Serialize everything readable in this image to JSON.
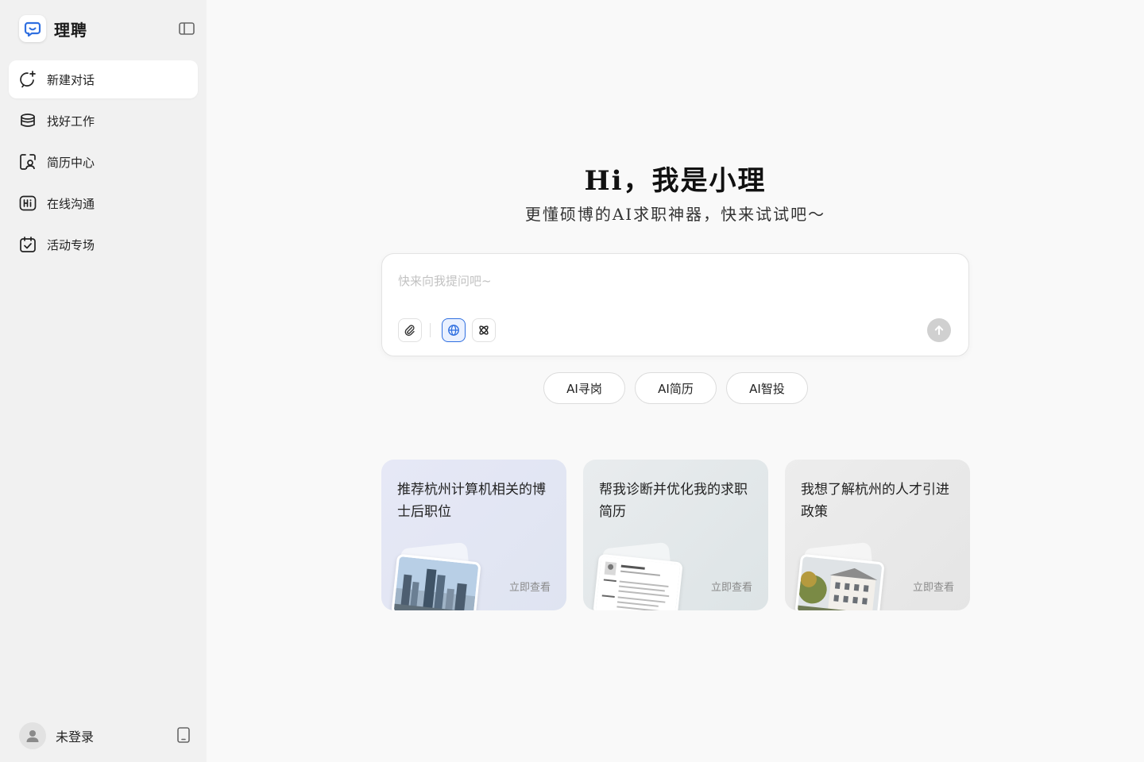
{
  "brand": {
    "name": "理聘",
    "accent": "#2f6fe0"
  },
  "sidebar": {
    "items": [
      {
        "label": "新建对话",
        "icon": "new-chat-icon",
        "active": true
      },
      {
        "label": "找好工作",
        "icon": "briefcase-icon",
        "active": false
      },
      {
        "label": "简历中心",
        "icon": "resume-icon",
        "active": false
      },
      {
        "label": "在线沟通",
        "icon": "hi-chat-icon",
        "active": false
      },
      {
        "label": "活动专场",
        "icon": "calendar-check-icon",
        "active": false
      }
    ],
    "user_label": "未登录"
  },
  "hero": {
    "title": "Hi，我是小理",
    "subtitle": "更懂硕博的AI求职神器，快来试试吧～"
  },
  "composer": {
    "placeholder": "快来向我提问吧~",
    "value": ""
  },
  "chips": [
    "AI寻岗",
    "AI简历",
    "AI智投"
  ],
  "cards": [
    {
      "title": "推荐杭州计算机相关的博士后职位",
      "link": "立即查看"
    },
    {
      "title": "帮我诊断并优化我的求职简历",
      "link": "立即查看"
    },
    {
      "title": "我想了解杭州的人才引进政策",
      "link": "立即查看"
    }
  ]
}
